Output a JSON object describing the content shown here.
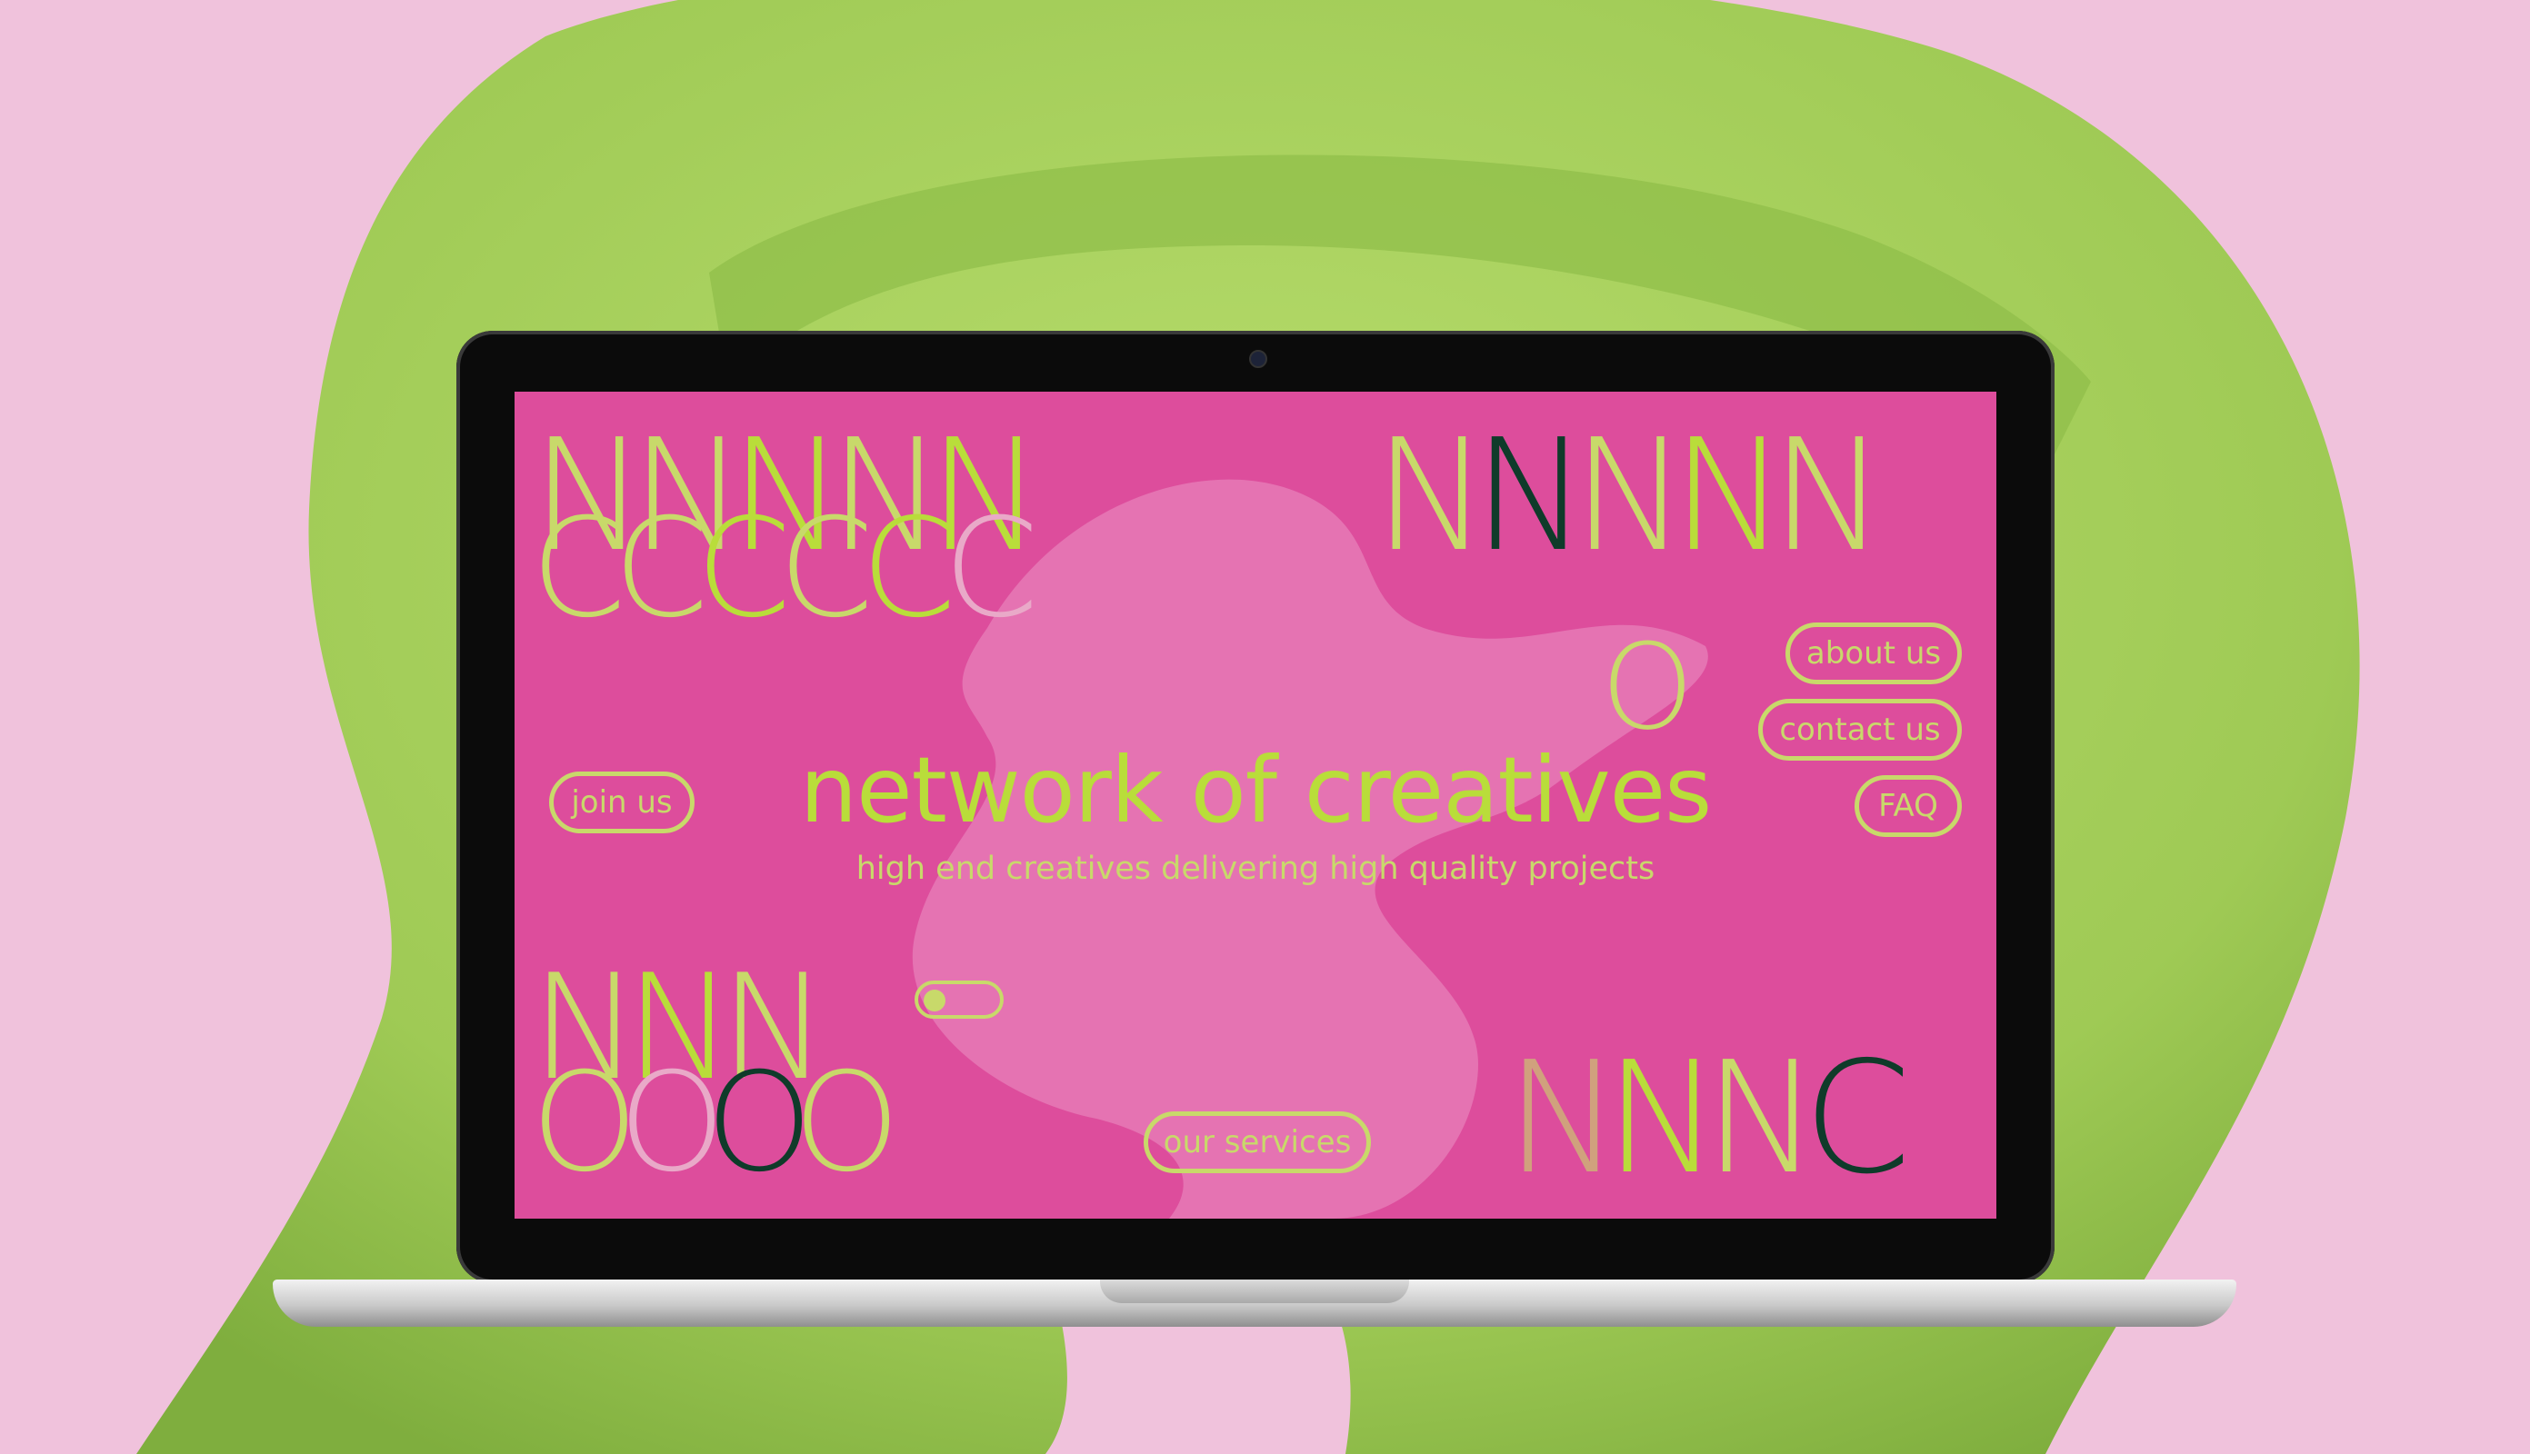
{
  "screen": {
    "glyphs": {
      "top_left_n": [
        "N",
        "N",
        "N",
        "N",
        "N"
      ],
      "top_left_c": [
        "C",
        "C",
        "C",
        "C",
        "C",
        "C"
      ],
      "top_right_n": [
        "N",
        "N",
        "N",
        "N",
        "N"
      ],
      "top_right_o": "O",
      "bottom_left_n": [
        "N",
        "N",
        "N"
      ],
      "bottom_left_o": [
        "O",
        "O",
        "O",
        "O"
      ],
      "bottom_right": [
        "N",
        "N",
        "N",
        "C"
      ]
    },
    "title": "network of creatives",
    "subtitle": "high end creatives delivering high quality projects",
    "buttons": {
      "about": "about us",
      "contact": "contact us",
      "faq": "FAQ",
      "join": "join us",
      "services": "our services"
    }
  },
  "colors": {
    "background": "#f0c2dc",
    "screen": "#dd4d9c",
    "lime": "#b9dd3a",
    "olive": "#c8d96a",
    "dark_green": "#0f3b2a",
    "sculpture": "#a7cf5a"
  }
}
